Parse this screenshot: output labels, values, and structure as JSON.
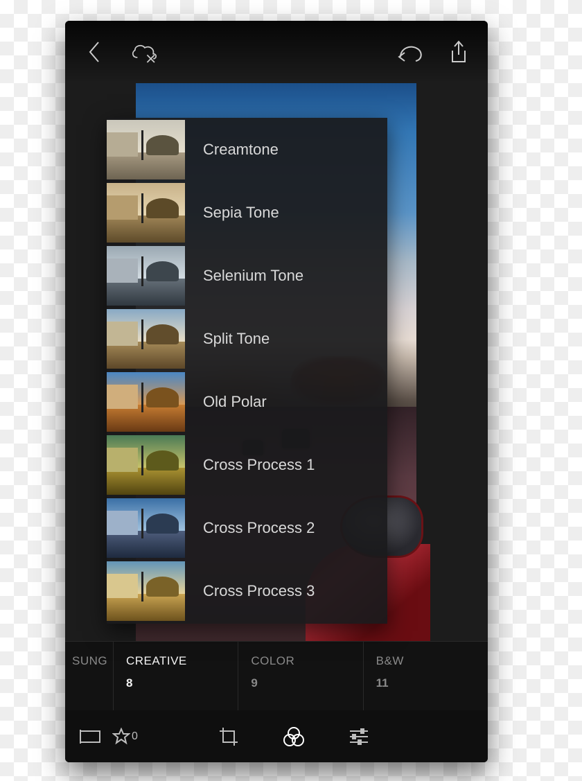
{
  "presets": [
    {
      "label": "Creamtone",
      "thumbClass": "t-cream"
    },
    {
      "label": "Sepia Tone",
      "thumbClass": "t-sepia"
    },
    {
      "label": "Selenium Tone",
      "thumbClass": "t-selenium"
    },
    {
      "label": "Split Tone",
      "thumbClass": "t-split"
    },
    {
      "label": "Old Polar",
      "thumbClass": "t-oldpolar"
    },
    {
      "label": "Cross Process 1",
      "thumbClass": "t-cp1"
    },
    {
      "label": "Cross Process 2",
      "thumbClass": "t-cp2"
    },
    {
      "label": "Cross Process 3",
      "thumbClass": "t-cp3"
    }
  ],
  "categories": [
    {
      "name": "SUNG",
      "count": "",
      "active": false,
      "partial": true
    },
    {
      "name": "CREATIVE",
      "count": "8",
      "active": true
    },
    {
      "name": "COLOR",
      "count": "9",
      "active": false
    },
    {
      "name": "B&W",
      "count": "11",
      "active": false
    }
  ],
  "rating": {
    "count": "0"
  }
}
